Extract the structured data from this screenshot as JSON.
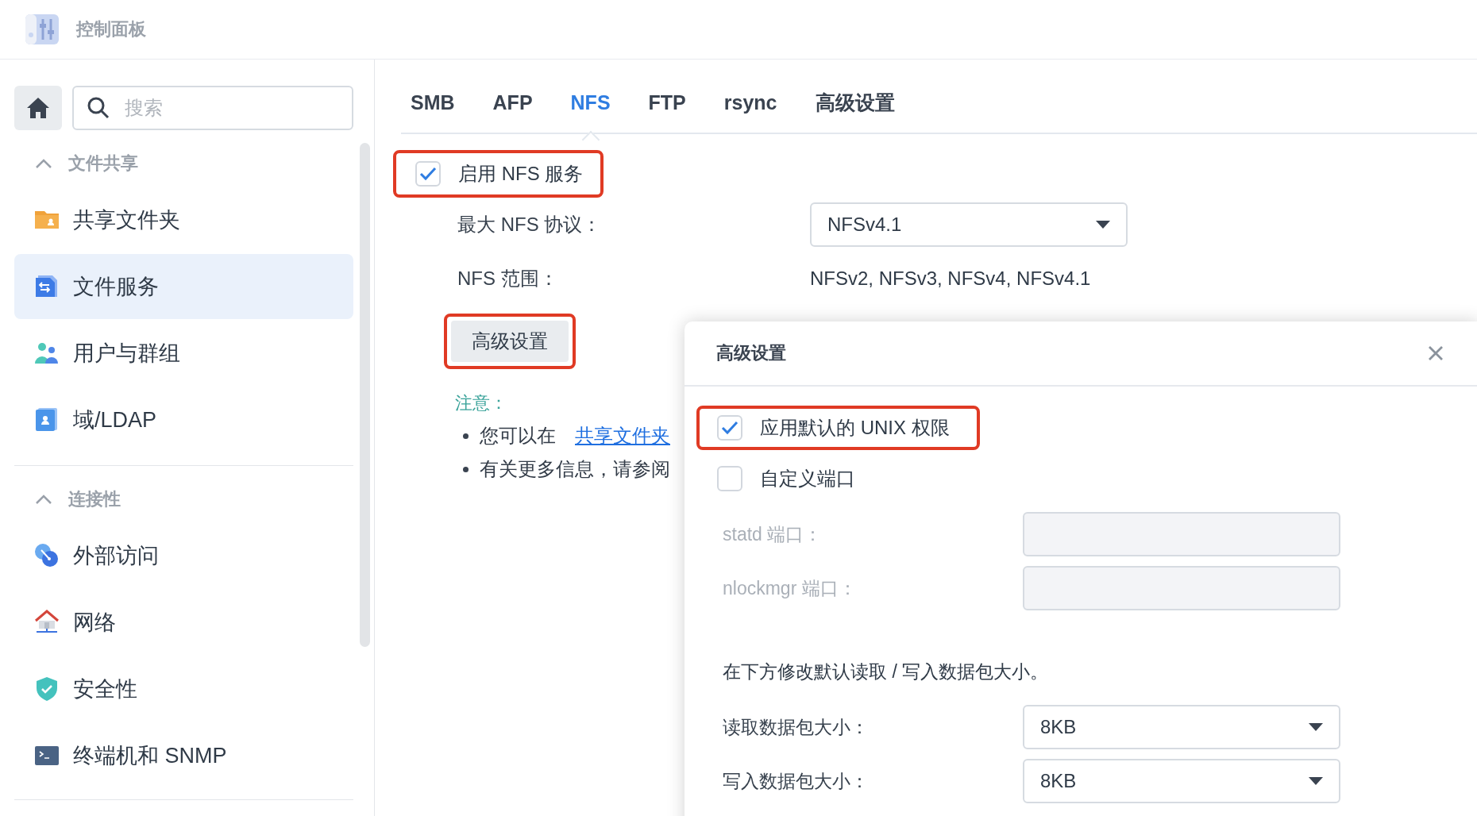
{
  "header": {
    "title": "控制面板"
  },
  "sidebar": {
    "search": {
      "placeholder": "搜索"
    },
    "groups": [
      {
        "title": "文件共享",
        "expanded": true,
        "items": [
          {
            "label": "共享文件夹",
            "selected": false
          },
          {
            "label": "文件服务",
            "selected": true
          },
          {
            "label": "用户与群组",
            "selected": false
          },
          {
            "label": "域/LDAP",
            "selected": false
          }
        ]
      },
      {
        "title": "连接性",
        "expanded": true,
        "items": [
          {
            "label": "外部访问",
            "selected": false
          },
          {
            "label": "网络",
            "selected": false
          },
          {
            "label": "安全性",
            "selected": false
          },
          {
            "label": "终端机和 SNMP",
            "selected": false
          }
        ]
      }
    ]
  },
  "tabs": [
    {
      "label": "SMB",
      "selected": false
    },
    {
      "label": "AFP",
      "selected": false
    },
    {
      "label": "NFS",
      "selected": true
    },
    {
      "label": "FTP",
      "selected": false
    },
    {
      "label": "rsync",
      "selected": false
    },
    {
      "label": "高级设置",
      "selected": false
    }
  ],
  "nfs": {
    "enable": {
      "label": "启用 NFS 服务",
      "checked": true,
      "highlighted": true
    },
    "max_protocol": {
      "label": "最大 NFS 协议：",
      "value": "NFSv4.1"
    },
    "range": {
      "label": "NFS 范围：",
      "value": "NFSv2, NFSv3, NFSv4, NFSv4.1"
    },
    "advanced_button": {
      "label": "高级设置",
      "highlighted": true
    },
    "note": {
      "title": "注意：",
      "bullets": [
        {
          "text": "您可以在",
          "link": "共享文件夹"
        },
        {
          "text": "有关更多信息，请参阅"
        }
      ]
    }
  },
  "dialog": {
    "title": "高级设置",
    "options": [
      {
        "label": "应用默认的 UNIX 权限",
        "checked": true,
        "highlighted": true
      },
      {
        "label": "自定义端口",
        "checked": false,
        "highlighted": false
      }
    ],
    "port_fields": [
      {
        "label": "statd 端口：",
        "disabled": true
      },
      {
        "label": "nlockmgr 端口：",
        "disabled": true
      }
    ],
    "description": "在下方修改默认读取 / 写入数据包大小。",
    "size_fields": [
      {
        "label": "读取数据包大小：",
        "value": "8KB"
      },
      {
        "label": "写入数据包大小：",
        "value": "8KB"
      }
    ]
  }
}
